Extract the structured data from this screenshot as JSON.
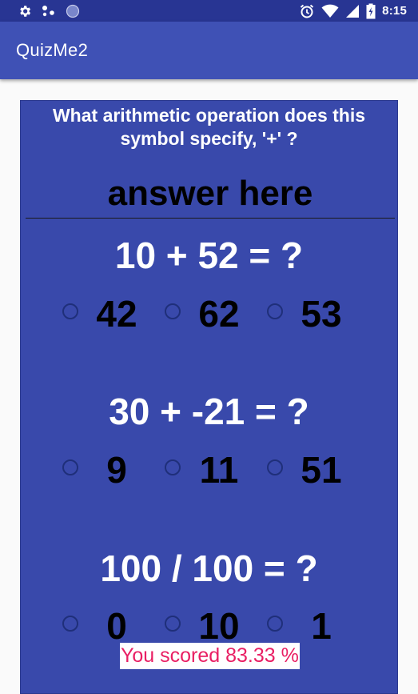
{
  "status_bar": {
    "time": "8:15",
    "left_icons": [
      "gear-icon",
      "dots-icon",
      "circle-icon"
    ],
    "right_icons": [
      "alarm-icon",
      "wifi-icon",
      "cell-signal-icon",
      "battery-charging-icon"
    ]
  },
  "app_bar": {
    "title": "QuizMe2"
  },
  "question": {
    "text": "What arithmetic operation does this symbol specify, '+' ?",
    "answer_placeholder": "answer here",
    "answer_value": ""
  },
  "problems": [
    {
      "equation": "10 + 52 = ?",
      "options": [
        "42",
        "62",
        "53"
      ],
      "selected": null
    },
    {
      "equation": "30 + -21 = ?",
      "options": [
        "9",
        "11",
        "51"
      ],
      "selected": null
    },
    {
      "equation": "100 / 100 = ?",
      "options": [
        "0",
        "10",
        "1"
      ],
      "selected": null
    }
  ],
  "score": {
    "text": "You scored 83.33 %"
  },
  "colors": {
    "status_bar": "#283593",
    "app_bar": "#3f51b5",
    "card": "#3949ab",
    "score_text": "#e91e63"
  }
}
